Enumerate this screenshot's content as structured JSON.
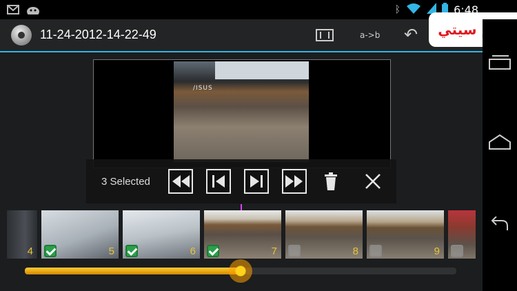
{
  "status_bar": {
    "time": "6:48"
  },
  "action_bar": {
    "title": "11-24-2012-14-22-49",
    "ab_label": "a->b"
  },
  "logo": {
    "text": "تايم سيتي"
  },
  "toolbar": {
    "selected_text": "3 Selected"
  },
  "filmstrip": {
    "frames": [
      {
        "number": "4",
        "selected": null
      },
      {
        "number": "5",
        "selected": true
      },
      {
        "number": "6",
        "selected": true
      },
      {
        "number": "7",
        "selected": true
      },
      {
        "number": "8",
        "selected": false
      },
      {
        "number": "9",
        "selected": false
      },
      {
        "number": "",
        "selected": false
      }
    ]
  },
  "slider": {
    "progress": 0.5
  },
  "colors": {
    "accent": "#33b5e5",
    "slider": "#ffb300",
    "check": "#2aa04a"
  }
}
